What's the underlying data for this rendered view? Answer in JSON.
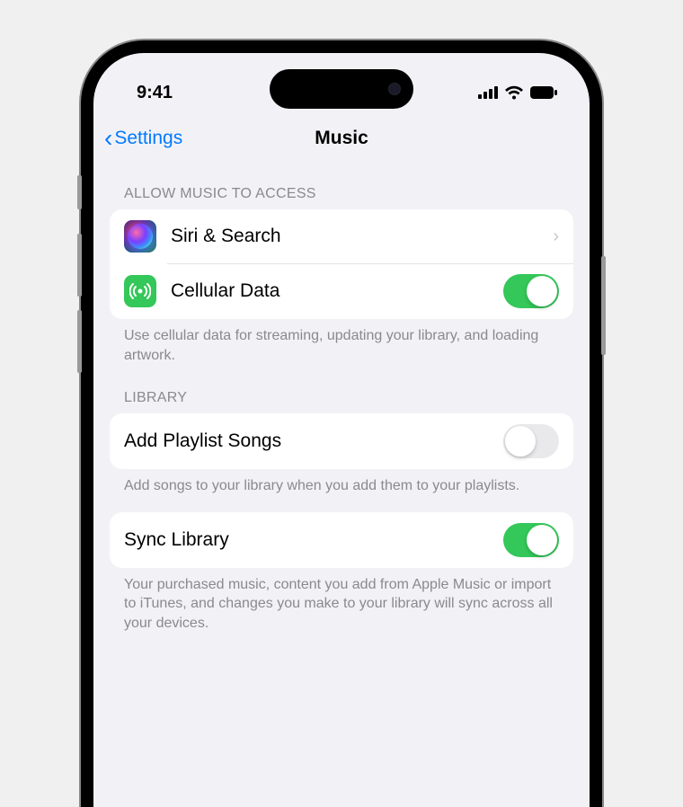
{
  "status": {
    "time": "9:41"
  },
  "nav": {
    "back_label": "Settings",
    "title": "Music"
  },
  "sections": {
    "access": {
      "header": "ALLOW MUSIC TO ACCESS",
      "siri_label": "Siri & Search",
      "cellular_label": "Cellular Data",
      "cellular_on": true,
      "footer": "Use cellular data for streaming, updating your library, and loading artwork."
    },
    "library": {
      "header": "LIBRARY",
      "add_playlist_label": "Add Playlist Songs",
      "add_playlist_on": false,
      "add_playlist_footer": "Add songs to your library when you add them to your playlists.",
      "sync_label": "Sync Library",
      "sync_on": true,
      "sync_footer": "Your purchased music, content you add from Apple Music or import to iTunes, and changes you make to your library will sync across all your devices."
    }
  }
}
